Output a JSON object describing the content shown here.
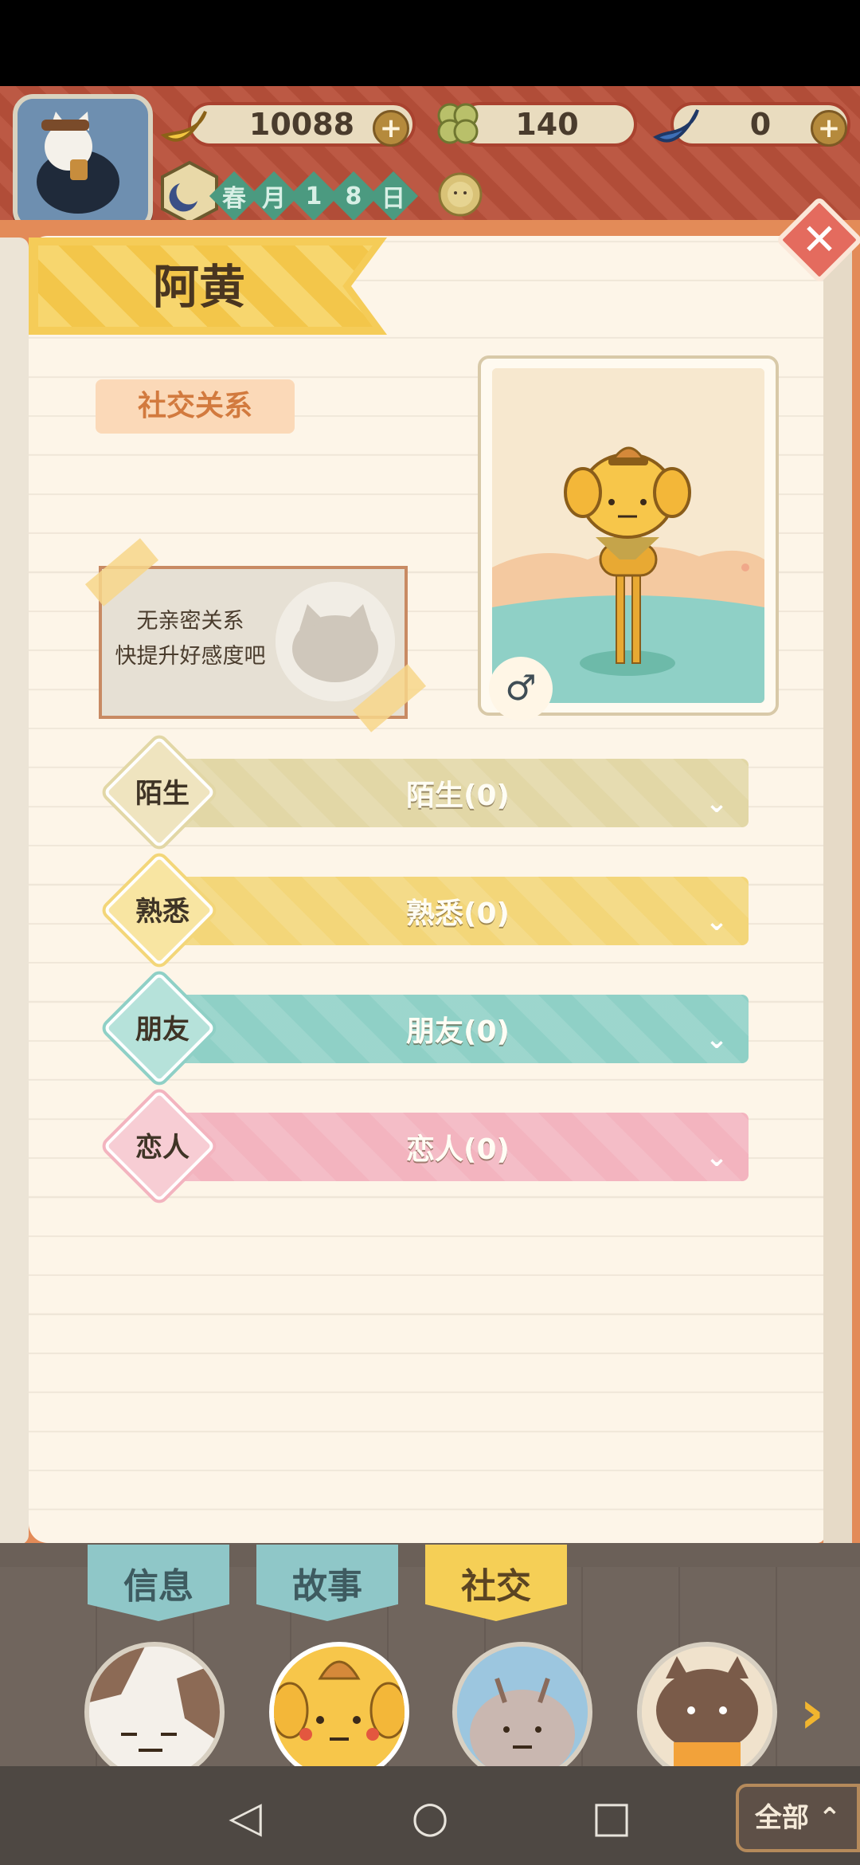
{
  "hud": {
    "bananas": "10088",
    "clovers": "140",
    "blue_bananas": "0",
    "plus": "+",
    "date": [
      "春",
      "月",
      "1",
      "8",
      "日"
    ]
  },
  "panel": {
    "title": "阿黄",
    "section_label": "社交关系",
    "close": "✕",
    "gender": "♂",
    "note_line1": "无亲密关系",
    "note_line2": "快提升好感度吧"
  },
  "relationships": [
    {
      "label": "陌生",
      "bar": "陌生(0)",
      "color": "#e2d7a6",
      "diamond": "#efe4bf"
    },
    {
      "label": "熟悉",
      "bar": "熟悉(0)",
      "color": "#f3d679",
      "diamond": "#f8e5a2"
    },
    {
      "label": "朋友",
      "bar": "朋友(0)",
      "color": "#8fd0c6",
      "diamond": "#b6e2da"
    },
    {
      "label": "恋人",
      "bar": "恋人(0)",
      "color": "#f3b4bf",
      "diamond": "#f7cdd4"
    }
  ],
  "tabs": [
    {
      "label": "信息",
      "bg": "#8fc7c8",
      "color": "#3e5b60"
    },
    {
      "label": "故事",
      "bg": "#8fc7c8",
      "color": "#3e5b60"
    },
    {
      "label": "社交",
      "bg": "#f5cf56",
      "color": "#5b4422"
    }
  ],
  "nav": {
    "back": "◁",
    "home": "○",
    "recent": "□",
    "all": "全部 ⌃",
    "next": "›"
  },
  "icons": {
    "close": "close-icon",
    "chevron": "chevron-down-icon",
    "gender": "male-icon"
  }
}
